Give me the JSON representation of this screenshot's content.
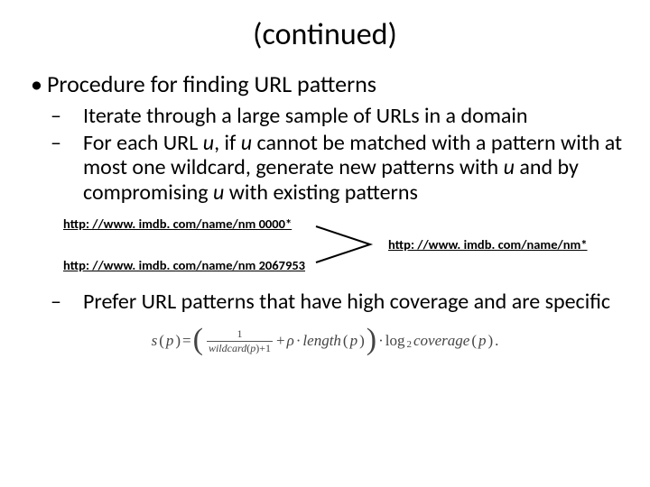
{
  "title": "(continued)",
  "lvl1": "Procedure for finding URL patterns",
  "bullets": {
    "b1": "Iterate through a large sample of URLs in a domain",
    "b2_pre": "For each URL ",
    "b2_u1": "u",
    "b2_mid1": ", if ",
    "b2_u2": "u",
    "b2_mid2": " cannot be matched with a pattern with at most one wildcard, generate new patterns with ",
    "b2_u3": "u",
    "b2_mid3": " and by compromising ",
    "b2_u4": "u",
    "b2_post": " with existing patterns",
    "b3": "Prefer URL patterns that have high coverage and are specific"
  },
  "urls": {
    "a": "http: //www. imdb. com/name/nm 0000*",
    "b": "http: //www. imdb. com/name/nm 2067953",
    "c": "http: //www. imdb. com/name/nm*"
  },
  "formula": {
    "sp": "s",
    "p_open": "(",
    "p_var": "p",
    "p_close": ")",
    "eq": " = ",
    "frac_num": "1",
    "frac_den_a": "wildcard",
    "frac_den_b": "(",
    "frac_den_c": "p",
    "frac_den_d": ")",
    "plus1": "+1",
    "plus": " + ",
    "rho": "ρ",
    "dot1": " · ",
    "length": "length",
    "lp_open": "(",
    "lp_var": "p",
    "lp_close": ")",
    "dot2": " · ",
    "log": "log",
    "log_sub": "2",
    "cov": "coverage",
    "cv_open": "(",
    "cv_var": "p",
    "cv_close": ")",
    "period": "."
  }
}
